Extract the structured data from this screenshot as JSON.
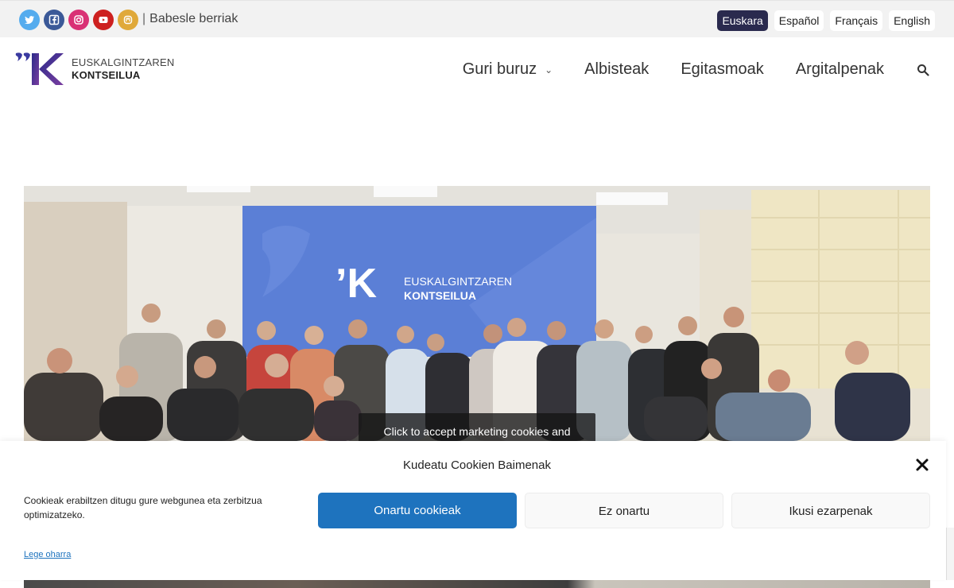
{
  "topbar": {
    "social": [
      {
        "name": "twitter-icon",
        "color": "#55acee"
      },
      {
        "name": "facebook-icon",
        "color": "#3b5998"
      },
      {
        "name": "instagram-icon",
        "color": "#d93175"
      },
      {
        "name": "youtube-icon",
        "color": "#cd201f"
      },
      {
        "name": "mastodon-icon",
        "color": "#e0a93a"
      }
    ],
    "separator": "|",
    "link": "Babesle berriak",
    "languages": [
      "Euskara",
      "Español",
      "Français",
      "English"
    ],
    "active_language": "Euskara"
  },
  "logo": {
    "line1": "EUSKALGINTZAREN",
    "line2": "KONTSEILUA"
  },
  "nav": {
    "items": [
      "Guri buruz",
      "Albisteak",
      "Egitasmoak",
      "Argitalpenak"
    ],
    "dropdown_icon": "chevron-down-icon",
    "search_icon": "search-icon"
  },
  "hero": {
    "banner_line1": "EUSKALGINTZAREN",
    "banner_line2": "KONTSEILUA",
    "overlay_text": "Click to accept marketing cookies and"
  },
  "cookie": {
    "title": "Kudeatu Cookien Baimenak",
    "text": "Cookieak erabiltzen ditugu gure webgunea eta zerbitzua optimizatzeko.",
    "accept": "Onartu cookieak",
    "deny": "Ez onartu",
    "preferences": "Ikusi ezarpenak",
    "legal": "Lege oharra"
  },
  "colors": {
    "accent": "#1e73be",
    "brand_dark": "#2a2a4e",
    "brand_purple": "#5b3ea0"
  }
}
